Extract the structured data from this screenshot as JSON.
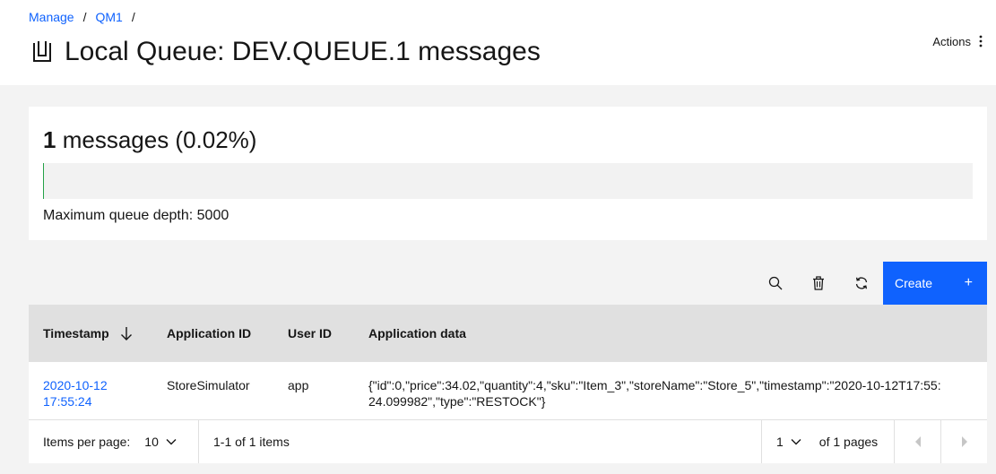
{
  "breadcrumb": {
    "items": [
      "Manage",
      "QM1"
    ],
    "separator": "/"
  },
  "page": {
    "title": "Local Queue: DEV.QUEUE.1 messages",
    "title_icon": "queue-icon",
    "actions_label": "Actions"
  },
  "depth": {
    "count": "1",
    "label": "messages (0.02%)",
    "fill_percent": 0.02,
    "max_text": "Maximum queue depth: 5000",
    "bar_color": "#24a148"
  },
  "toolbar": {
    "icons": [
      "search-icon",
      "trash-icon",
      "refresh-icon"
    ],
    "create_label": "Create",
    "create_icon": "+"
  },
  "table": {
    "headers": {
      "timestamp": "Timestamp",
      "application_id": "Application ID",
      "user_id": "User ID",
      "application_data": "Application data"
    },
    "rows": [
      {
        "timestamp": "2020-10-12 17:55:24",
        "application_id": "StoreSimulator",
        "user_id": "app",
        "application_data": "{\"id\":0,\"price\":34.02,\"quantity\":4,\"sku\":\"Item_3\",\"storeName\":\"Store_5\",\"timestamp\":\"2020-10-12T17:55:24.099982\",\"type\":\"RESTOCK\"}"
      }
    ]
  },
  "pagination": {
    "items_per_page_label": "Items per page:",
    "items_per_page_value": "10",
    "range_text": "1-1 of 1 items",
    "page_value": "1",
    "pages_text": "of 1 pages"
  },
  "colors": {
    "accent": "#0f62fe",
    "header_bg": "#e0e0e0",
    "page_bg": "#f3f3f3"
  }
}
